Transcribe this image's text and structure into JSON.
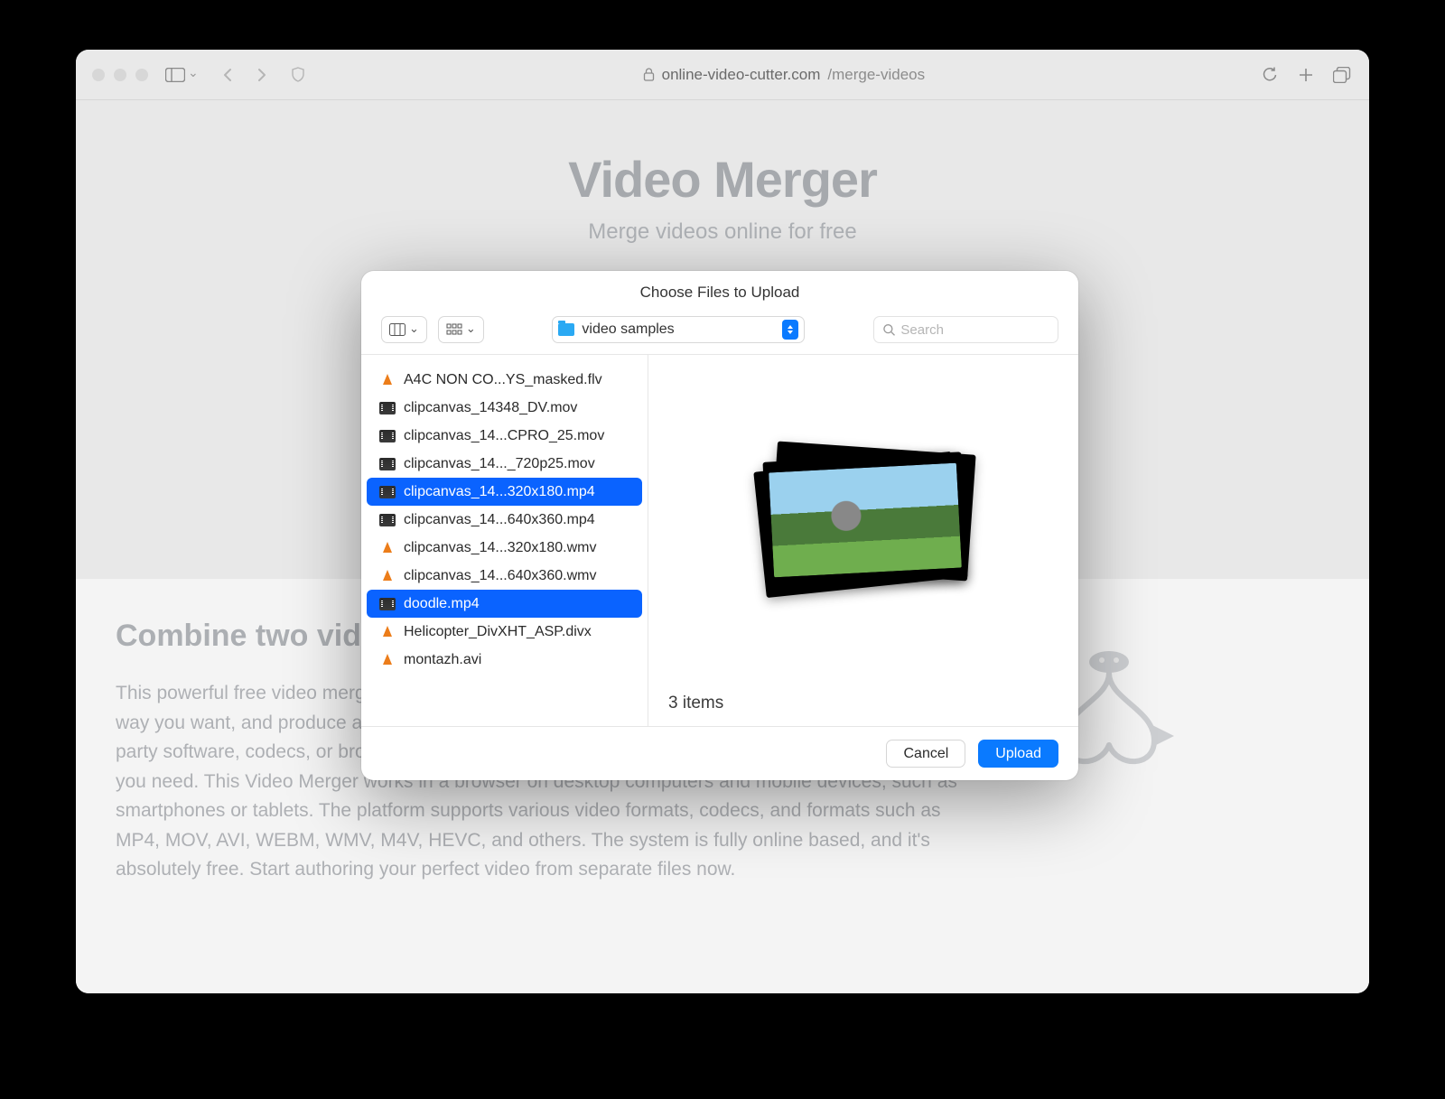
{
  "browser": {
    "url_host": "online-video-cutter.com",
    "url_path": "/merge-videos"
  },
  "page": {
    "title": "Video Merger",
    "subtitle": "Merge videos online for free",
    "section_title": "Combine two videos",
    "section_body": "This powerful free video merger can combine multiple unrelated videos into one, trim the videos any way you want, and produce a professional and exciting video. No need to download or install any third party software, codecs, or browser extensions. There is no learning curve, and the UI has every tool you need. This Video Merger works in a browser on desktop computers and mobile devices, such as smartphones or tablets. The platform supports various video formats, codecs, and formats such as MP4, MOV, AVI, WEBM, WMV, M4V, HEVC, and others. The system is fully online based, and it's absolutely free. Start authoring your perfect video from separate files now."
  },
  "dialog": {
    "title": "Choose Files to Upload",
    "folder": "video samples",
    "search_placeholder": "Search",
    "item_count": "3 items",
    "cancel": "Cancel",
    "upload": "Upload",
    "files": [
      {
        "name": "A4C NON CO...YS_masked.flv",
        "icon": "vlc",
        "selected": false
      },
      {
        "name": "clipcanvas_14348_DV.mov",
        "icon": "video",
        "selected": false
      },
      {
        "name": "clipcanvas_14...CPRO_25.mov",
        "icon": "video",
        "selected": false
      },
      {
        "name": "clipcanvas_14..._720p25.mov",
        "icon": "video",
        "selected": false
      },
      {
        "name": "clipcanvas_14...320x180.mp4",
        "icon": "video",
        "selected": true
      },
      {
        "name": "clipcanvas_14...640x360.mp4",
        "icon": "video",
        "selected": false
      },
      {
        "name": "clipcanvas_14...320x180.wmv",
        "icon": "vlc",
        "selected": false
      },
      {
        "name": "clipcanvas_14...640x360.wmv",
        "icon": "vlc",
        "selected": false
      },
      {
        "name": "doodle.mp4",
        "icon": "video",
        "selected": true
      },
      {
        "name": "Helicopter_DivXHT_ASP.divx",
        "icon": "vlc",
        "selected": false
      },
      {
        "name": "montazh.avi",
        "icon": "vlc",
        "selected": false
      }
    ]
  }
}
